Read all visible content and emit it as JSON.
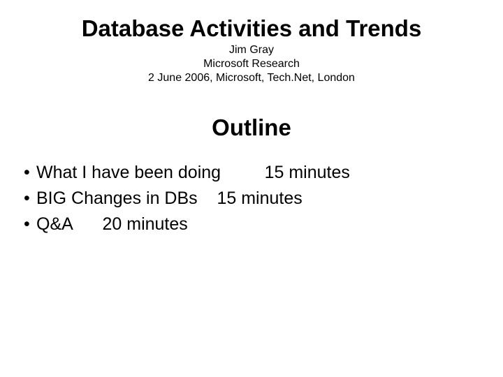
{
  "title": "Database Activities and Trends",
  "author": {
    "name": "Jim Gray",
    "affiliation": "Microsoft Research",
    "event": "2 June 2006, Microsoft, Tech.Net, London"
  },
  "section": "Outline",
  "items": [
    {
      "text": "What I have been doing",
      "duration": "15 minutes",
      "spacer": "         "
    },
    {
      "text": "BIG Changes in DBs",
      "duration": "15 minutes",
      "spacer": "    "
    },
    {
      "text": "Q&A",
      "duration": "20 minutes",
      "spacer": "      "
    }
  ]
}
